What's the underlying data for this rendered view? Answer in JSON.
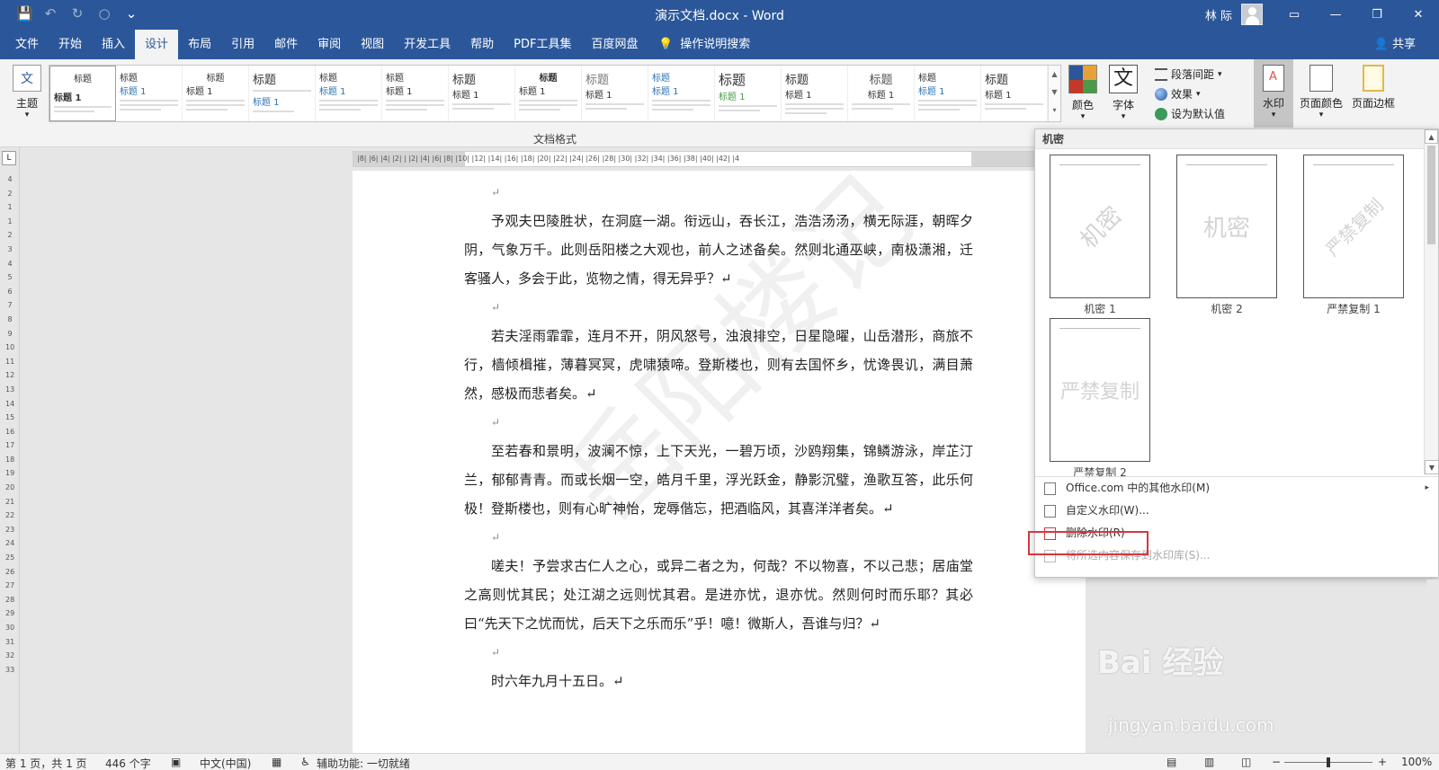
{
  "titlebar": {
    "title": "演示文档.docx  -  Word",
    "user": "林 际",
    "qat": {
      "save_icon": "💾",
      "undo_icon": "↶",
      "redo_icon": "↻",
      "circle_icon": "○",
      "customize_icon": "⌄"
    },
    "window_buttons": {
      "ribbon_display": "▭",
      "minimize": "—",
      "restore": "❐",
      "close": "✕"
    }
  },
  "menu": {
    "tabs": [
      "文件",
      "开始",
      "插入",
      "设计",
      "布局",
      "引用",
      "邮件",
      "审阅",
      "视图",
      "开发工具",
      "帮助",
      "PDF工具集",
      "百度网盘"
    ],
    "active_tab": "设计",
    "tell_me_icon": "💡",
    "tell_me": "操作说明搜索",
    "share": "共享",
    "share_icon": "👤"
  },
  "ribbon": {
    "theme_label": "主题",
    "theme_arrow": "▾",
    "gallery_label": "文档格式",
    "gallery_sample_title": "标题",
    "gallery_sample_heading": "标题 1",
    "gallery_first_title": "标题",
    "gallery_first_heading": "标题 1",
    "gallery_scroll": {
      "up": "▲",
      "down": "▼",
      "more": "▾"
    },
    "colors_label": "颜色",
    "fonts_label": "字体",
    "fonts_icon_text": "文",
    "dropdown_arrow": "▾",
    "paragraph_spacing": "段落间距",
    "effects": "效果",
    "set_default": "设为默认值",
    "watermark": "水印",
    "page_color": "页面颜色",
    "page_borders": "页面边框",
    "colors": {
      "accent": "#2b579a",
      "highlight": "#d9363e"
    }
  },
  "ruler": {
    "corner": "L",
    "horizontal": "|8|  |6|  |4|  |2|  |   |2|  |4|  |6|  |8|  |10|  |12|  |14|  |16|  |18|  |20|  |22|  |24|  |26|  |28|  |30|  |32|  |34|  |36|  |38|  |40|  |42|  |4",
    "vertical": [
      "4",
      "",
      "2",
      "",
      "1",
      "1",
      "2",
      "3",
      "4",
      "5",
      "6",
      "7",
      "8",
      "9",
      "10",
      "11",
      "12",
      "13",
      "14",
      "15",
      "16",
      "17",
      "18",
      "19",
      "20",
      "21",
      "22",
      "23",
      "24",
      "25",
      "26",
      "27",
      "28",
      "29",
      "30",
      "31",
      "32",
      "33"
    ]
  },
  "document": {
    "pilcrow": "↵",
    "paragraphs": [
      "予观夫巴陵胜状，在洞庭一湖。衔远山，吞长江，浩浩汤汤，横无际涯，朝晖夕阴，气象万千。此则岳阳楼之大观也，前人之述备矣。然则北通巫峡，南极潇湘，迁客骚人，多会于此，览物之情，得无异乎？↵",
      "若夫淫雨霏霏，连月不开，阴风怒号，浊浪排空，日星隐曜，山岳潜形，商旅不行，樯倾楫摧，薄暮冥冥，虎啸猿啼。登斯楼也，则有去国怀乡，忧谗畏讥，满目萧然，感极而悲者矣。↵",
      "至若春和景明，波澜不惊，上下天光，一碧万顷，沙鸥翔集，锦鳞游泳，岸芷汀兰，郁郁青青。而或长烟一空，皓月千里，浮光跃金，静影沉璧，渔歌互答，此乐何极！登斯楼也，则有心旷神怡，宠辱偕忘，把酒临风，其喜洋洋者矣。↵",
      "嗟夫！予尝求古仁人之心，或异二者之为，何哉？不以物喜，不以己悲；居庙堂之高则忧其民；处江湖之远则忧其君。是进亦忧，退亦忧。然则何时而乐耶？其必曰“先天下之忧而忧，后天下之乐而乐”乎！噫！微斯人，吾谁与归？↵",
      "时六年九月十五日。↵"
    ],
    "watermark": "岳阳楼记"
  },
  "watermark_menu": {
    "header": "机密",
    "tiles": [
      {
        "caption": "机密 1",
        "text": "机密"
      },
      {
        "caption": "机密 2",
        "text": "机密"
      },
      {
        "caption": "严禁复制 1",
        "text": "严禁复制"
      },
      {
        "caption": "严禁复制 2",
        "text": "严禁复制"
      }
    ],
    "scroll": {
      "up": "▲",
      "down": "▼"
    },
    "items": [
      {
        "label": "Office.com 中的其他水印(M)",
        "arrow": "▸"
      },
      {
        "label": "自定义水印(W)..."
      },
      {
        "label": "删除水印(R)"
      },
      {
        "label": "将所选内容保存到水印库(S)..."
      }
    ]
  },
  "statusbar": {
    "page": "第 1 页，共 1 页",
    "words": "446 个字",
    "proof_icon": "▣",
    "language": "中文(中国)",
    "macro_icon": "▦",
    "accessibility": "辅助功能: 一切就绪",
    "access_icon": "♿",
    "view_read": "▤",
    "view_print": "▥",
    "view_web": "◫",
    "zoom_out": "−",
    "zoom_in": "+",
    "zoom": "100%"
  },
  "overlay_watermark": {
    "brand": "Bai 经验",
    "url": "jingyan.baidu.com"
  }
}
